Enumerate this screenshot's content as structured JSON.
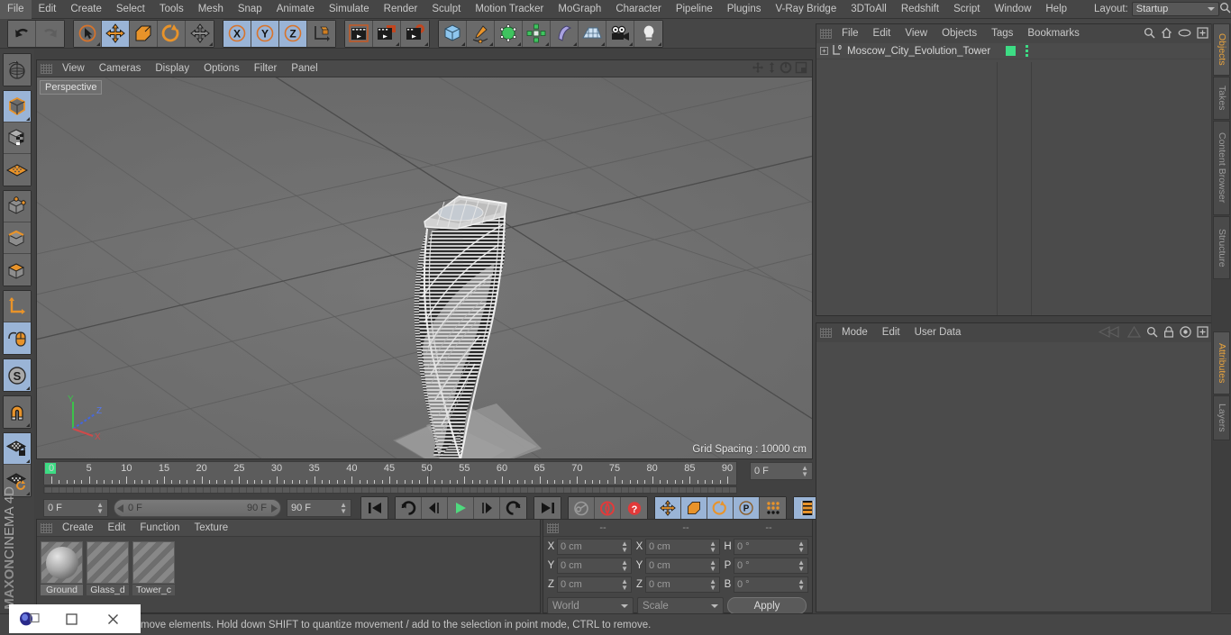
{
  "app": {
    "name": "MAXON",
    "product": "CINEMA 4D"
  },
  "menubar": {
    "items": [
      "File",
      "Edit",
      "Create",
      "Select",
      "Tools",
      "Mesh",
      "Snap",
      "Animate",
      "Simulate",
      "Render",
      "Sculpt",
      "Motion Tracker",
      "MoGraph",
      "Character",
      "Pipeline",
      "Plugins",
      "V-Ray Bridge",
      "3DToAll",
      "Redshift",
      "Script",
      "Window",
      "Help"
    ],
    "layout_label": "Layout:",
    "layout_value": "Startup",
    "search_icon": "search-icon"
  },
  "toolbar": {
    "groups": [
      {
        "name": "undo-redo",
        "buttons": [
          {
            "name": "undo-button",
            "icon": "undo-icon",
            "active": false
          },
          {
            "name": "redo-button",
            "icon": "redo-icon",
            "active": false,
            "disabled": true
          }
        ]
      },
      {
        "name": "transform-tools",
        "buttons": [
          {
            "name": "select-tool",
            "icon": "live-selection-icon",
            "active": false
          },
          {
            "name": "move-tool",
            "icon": "move-icon",
            "active": true
          },
          {
            "name": "scale-tool",
            "icon": "scale-icon",
            "active": false
          },
          {
            "name": "rotate-tool",
            "icon": "rotate-icon",
            "active": false
          },
          {
            "name": "global-move-tool",
            "icon": "move-icon",
            "active": false
          }
        ]
      },
      {
        "name": "axis-locks",
        "buttons": [
          {
            "name": "lock-x-axis",
            "icon": "x-axis-icon",
            "active": true
          },
          {
            "name": "lock-y-axis",
            "icon": "y-axis-icon",
            "active": true
          },
          {
            "name": "lock-z-axis",
            "icon": "z-axis-icon",
            "active": true
          },
          {
            "name": "world-coordinate-system",
            "icon": "world-axis-icon",
            "active": false
          }
        ]
      },
      {
        "name": "render-tools",
        "buttons": [
          {
            "name": "render-view-button",
            "icon": "render-view-icon",
            "active": false
          },
          {
            "name": "render-to-picture-viewer-button",
            "icon": "render-picture-viewer-icon",
            "active": false
          },
          {
            "name": "render-settings-button",
            "icon": "render-settings-icon",
            "active": false
          }
        ]
      },
      {
        "name": "creation-tools",
        "buttons": [
          {
            "name": "add-primitive-button",
            "icon": "cube-icon",
            "active": false
          },
          {
            "name": "add-spline-button",
            "icon": "pen-spline-icon",
            "active": false
          },
          {
            "name": "add-generator-button",
            "icon": "generator-icon",
            "active": false
          },
          {
            "name": "add-mograph-button",
            "icon": "mograph-cloner-icon",
            "active": false
          },
          {
            "name": "add-deformer-button",
            "icon": "bend-deformer-icon",
            "active": false
          },
          {
            "name": "add-scene-object-button",
            "icon": "floor-icon",
            "active": false
          },
          {
            "name": "add-camera-button",
            "icon": "camera-icon",
            "active": false
          },
          {
            "name": "add-light-button",
            "icon": "light-bulb-icon",
            "active": false
          }
        ]
      }
    ]
  },
  "left_toolbar": {
    "groups": [
      {
        "name": "undo-view-group",
        "buttons": [
          {
            "name": "undo-view-button",
            "icon": "globe-wire-icon",
            "active": false
          }
        ]
      },
      {
        "name": "selection-mode-group",
        "buttons": [
          {
            "name": "model-mode-button",
            "icon": "model-cube-icon",
            "active": true
          },
          {
            "name": "texture-mode-button",
            "icon": "texture-cube-icon",
            "active": false
          },
          {
            "name": "workplane-mode-button",
            "icon": "workplane-grid-icon",
            "active": false
          }
        ]
      },
      {
        "name": "component-mode-group",
        "buttons": [
          {
            "name": "points-mode-button",
            "icon": "points-cube-icon",
            "active": false
          },
          {
            "name": "edges-mode-button",
            "icon": "edges-cube-icon",
            "active": false
          },
          {
            "name": "polygons-mode-button",
            "icon": "polygons-cube-icon",
            "active": false
          }
        ]
      },
      {
        "name": "axis-group",
        "buttons": [
          {
            "name": "enable-axis-modification-button",
            "icon": "axis-l-icon",
            "active": false
          },
          {
            "name": "viewport-solo-button",
            "icon": "mouse-icon",
            "active": true
          }
        ]
      },
      {
        "name": "snap-group",
        "buttons": [
          {
            "name": "enable-snap-button",
            "icon": "snap-s-icon",
            "active": true
          }
        ]
      },
      {
        "name": "magnet-group",
        "buttons": [
          {
            "name": "magnet-tool-button",
            "icon": "magnet-icon",
            "active": false
          }
        ]
      },
      {
        "name": "workplane-group",
        "buttons": [
          {
            "name": "lock-workplane-button",
            "icon": "workplane-lock-icon",
            "active": true
          },
          {
            "name": "planar-workplane-button",
            "icon": "workplane-rotate-icon",
            "active": false
          }
        ]
      }
    ]
  },
  "viewport": {
    "menu": [
      "View",
      "Cameras",
      "Display",
      "Options",
      "Filter",
      "Panel"
    ],
    "header_icons": [
      "pan-view-icon",
      "dolly-view-icon",
      "rotate-view-icon",
      "maximize-viewport-icon"
    ],
    "camera_label": "Perspective",
    "grid_spacing": "Grid Spacing : 10000 cm",
    "axis_gizmo": {
      "y": "Y",
      "z": "Z",
      "x": "X",
      "y_color": "#3cc24a",
      "z_color": "#4466dd",
      "x_color": "#d04a4a"
    },
    "scene_object": "twisted tower wireframe model"
  },
  "timeline": {
    "ruler_labels": [
      "0",
      "5",
      "10",
      "15",
      "20",
      "25",
      "30",
      "35",
      "40",
      "45",
      "50",
      "55",
      "60",
      "65",
      "70",
      "75",
      "80",
      "85",
      "90"
    ],
    "current_frame_field": "0 F",
    "start_field": "0 F",
    "range_start": "0 F",
    "range_end": "90 F",
    "end_field": "90 F",
    "playhead_frame": 0,
    "buttons": [
      {
        "name": "go-to-start-button",
        "icon": "skip-start-icon",
        "active": false
      },
      {
        "name": "play-backwards-step-button",
        "icon": "step-back-icon",
        "active": false
      },
      {
        "name": "go-to-previous-frame-button",
        "icon": "prev-frame-icon",
        "active": false
      },
      {
        "name": "play-button",
        "icon": "play-icon",
        "active": false
      },
      {
        "name": "go-to-next-frame-button",
        "icon": "next-frame-icon",
        "active": false
      },
      {
        "name": "loop-button",
        "icon": "loop-icon",
        "active": false
      },
      {
        "name": "go-to-end-button",
        "icon": "skip-end-icon",
        "active": false
      },
      {
        "name": "record-active-objects-button",
        "icon": "key-icon",
        "active": false
      },
      {
        "name": "autokeying-button",
        "icon": "autokey-icon",
        "active": false
      },
      {
        "name": "keyframe-selection-button",
        "icon": "keyframe-question-icon",
        "active": false
      },
      {
        "name": "position-key-button",
        "icon": "move-icon",
        "active": true
      },
      {
        "name": "scale-key-button",
        "icon": "scale-icon",
        "active": true
      },
      {
        "name": "rotation-key-button",
        "icon": "rotate-icon",
        "active": true
      },
      {
        "name": "parameter-key-button",
        "icon": "param-p-icon",
        "active": true
      },
      {
        "name": "pla-key-button",
        "icon": "pla-dots-icon",
        "active": false
      },
      {
        "name": "timeline-mode-button",
        "icon": "film-strip-icon",
        "active": true
      }
    ]
  },
  "material_manager": {
    "menu": [
      "Create",
      "Edit",
      "Function",
      "Texture"
    ],
    "materials": [
      {
        "name": "Ground",
        "selected": true,
        "preview": "sphere"
      },
      {
        "name": "Glass_d",
        "selected": false,
        "preview": "empty"
      },
      {
        "name": "Tower_c",
        "selected": false,
        "preview": "empty"
      }
    ]
  },
  "coordinates": {
    "headers": [
      "--",
      "--",
      "--"
    ],
    "rows": [
      {
        "label_pos": "X",
        "value_pos": "0 cm",
        "label_size": "X",
        "value_size": "0 cm",
        "label_rot": "H",
        "value_rot": "0 °"
      },
      {
        "label_pos": "Y",
        "value_pos": "0 cm",
        "label_size": "Y",
        "value_size": "0 cm",
        "label_rot": "P",
        "value_rot": "0 °"
      },
      {
        "label_pos": "Z",
        "value_pos": "0 cm",
        "label_size": "Z",
        "value_size": "0 cm",
        "label_rot": "B",
        "value_rot": "0 °"
      }
    ],
    "system_select": "World",
    "mode_select": "Scale",
    "apply_label": "Apply"
  },
  "object_manager": {
    "menu": [
      "File",
      "Edit",
      "View",
      "Objects",
      "Tags",
      "Bookmarks"
    ],
    "header_icons": [
      "search-icon",
      "home-icon",
      "eye-icon",
      "plus-box-icon"
    ],
    "objects": [
      {
        "name": "Moscow_City_Evolution_Tower",
        "expandable": true,
        "layer_badge": "0",
        "tag_color": "#3ddc84"
      }
    ]
  },
  "attributes_panel": {
    "menu": [
      "Mode",
      "Edit",
      "User Data"
    ],
    "header_icons": [
      "history-back-icon",
      "history-forward-icon",
      "search-icon",
      "lock-icon",
      "target-icon",
      "plus-box-icon"
    ],
    "content": ""
  },
  "right_tabs": {
    "top": [
      {
        "label": "Objects",
        "active": true
      },
      {
        "label": "Takes",
        "active": false
      },
      {
        "label": "Content Browser",
        "active": false
      },
      {
        "label": "Structure",
        "active": false
      }
    ],
    "bottom": [
      {
        "label": "Attributes",
        "active": true
      },
      {
        "label": "Layers",
        "active": false
      }
    ],
    "active_color": "#e8a33d"
  },
  "statusbar": {
    "text": "move elements. Hold down SHIFT to quantize movement / add to the selection in point mode, CTRL to remove."
  },
  "window_overlay": {
    "buttons": [
      {
        "name": "app-icon",
        "glyph": "◉"
      },
      {
        "name": "restore-window-button",
        "glyph": "❐"
      },
      {
        "name": "close-window-button",
        "glyph": "✕"
      }
    ]
  },
  "colors": {
    "chrome": "#464646",
    "panel": "#4b4b4b",
    "button": "#6a6a6a",
    "active_blue": "#9ab4d6",
    "orange": "#e8932a",
    "green": "#3ddc84",
    "viewport_bg": "#6e6e6e"
  }
}
